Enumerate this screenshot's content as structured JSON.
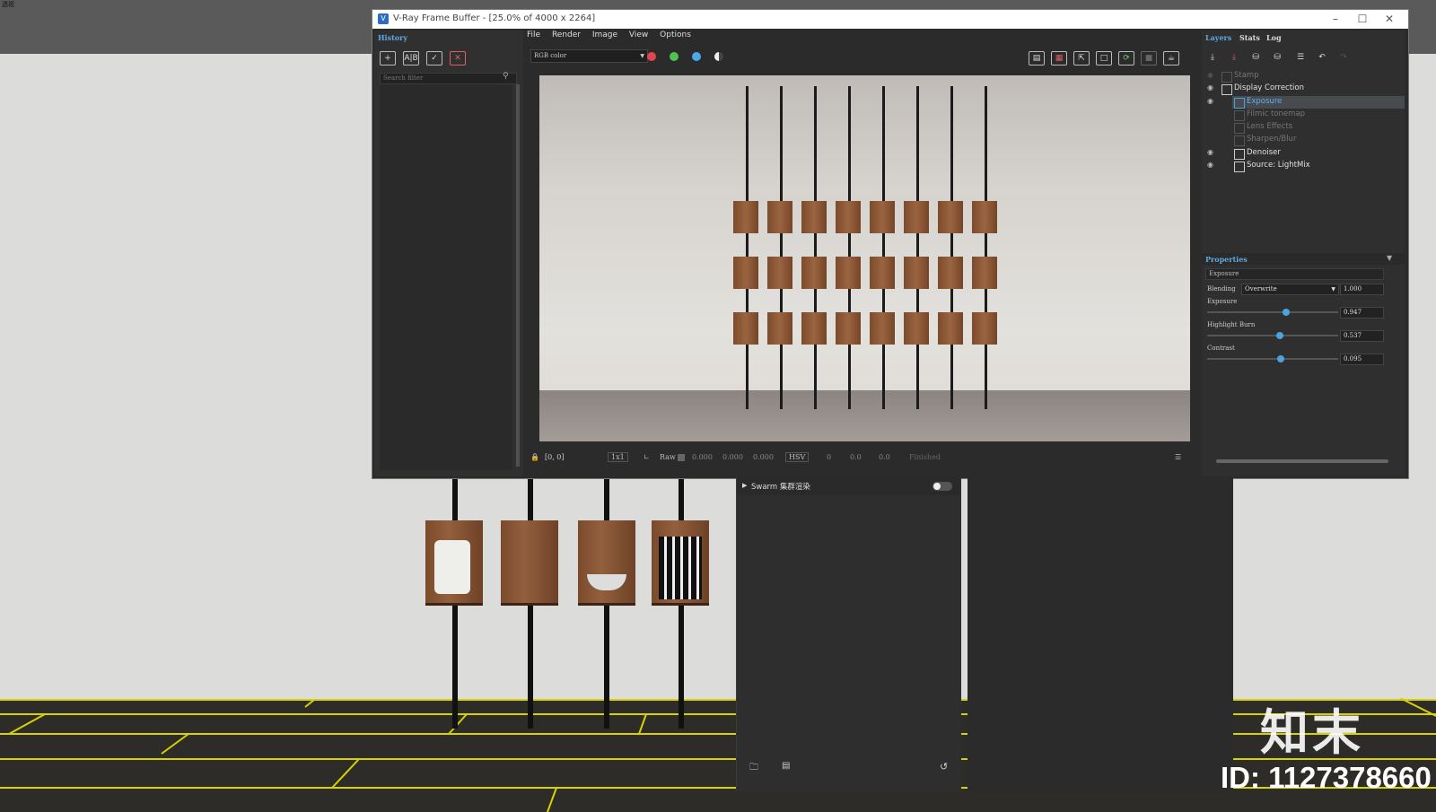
{
  "viewport": {
    "corner_text": "透视"
  },
  "vfb": {
    "title": "V-Ray Frame Buffer - [25.0% of 4000 x 2264]",
    "history_tab": "History",
    "search_placeholder": "Search filter",
    "menu": [
      "File",
      "Render",
      "Image",
      "View",
      "Options"
    ],
    "channel": "RGB color",
    "status": {
      "coords": "[0, 0]",
      "zoom": "1x1",
      "mode": "Raw",
      "r": "0.000",
      "g": "0.000",
      "b": "0.000",
      "colorspace": "HSV",
      "h": "0",
      "s": "0.0",
      "v": "0.0",
      "state": "Finished"
    }
  },
  "layers_panel": {
    "tabs": [
      "Layers",
      "Stats",
      "Log"
    ],
    "layers": [
      {
        "label": "Stamp",
        "visible": false
      },
      {
        "label": "Display Correction",
        "visible": true
      },
      {
        "label": "Exposure",
        "visible": true,
        "selected": true
      },
      {
        "label": "Filmic tonemap",
        "visible": false
      },
      {
        "label": "Lens Effects",
        "visible": false
      },
      {
        "label": "Sharpen/Blur",
        "visible": false
      },
      {
        "label": "Denoiser",
        "visible": true
      },
      {
        "label": "Source: LightMix",
        "visible": true
      }
    ]
  },
  "properties": {
    "header": "Properties",
    "section": "Exposure",
    "blending_label": "Blending",
    "blending_mode": "Overwrite",
    "blending_value": "1.000",
    "exposure_label": "Exposure",
    "exposure_value": "0.947",
    "highlight_label": "Highlight Burn",
    "highlight_value": "0.537",
    "contrast_label": "Contrast",
    "contrast_value": "0.095"
  },
  "swarm": {
    "label": "Swarm 集群渲染",
    "enabled": false
  },
  "watermark": {
    "logo": "知末",
    "id": "ID: 1127378660"
  },
  "colors": {
    "accent": "#4aa3e0",
    "tab_accent": "#5fa8e0",
    "red": "#e0474c",
    "green": "#4fc24f",
    "blue": "#4aa8e8"
  }
}
